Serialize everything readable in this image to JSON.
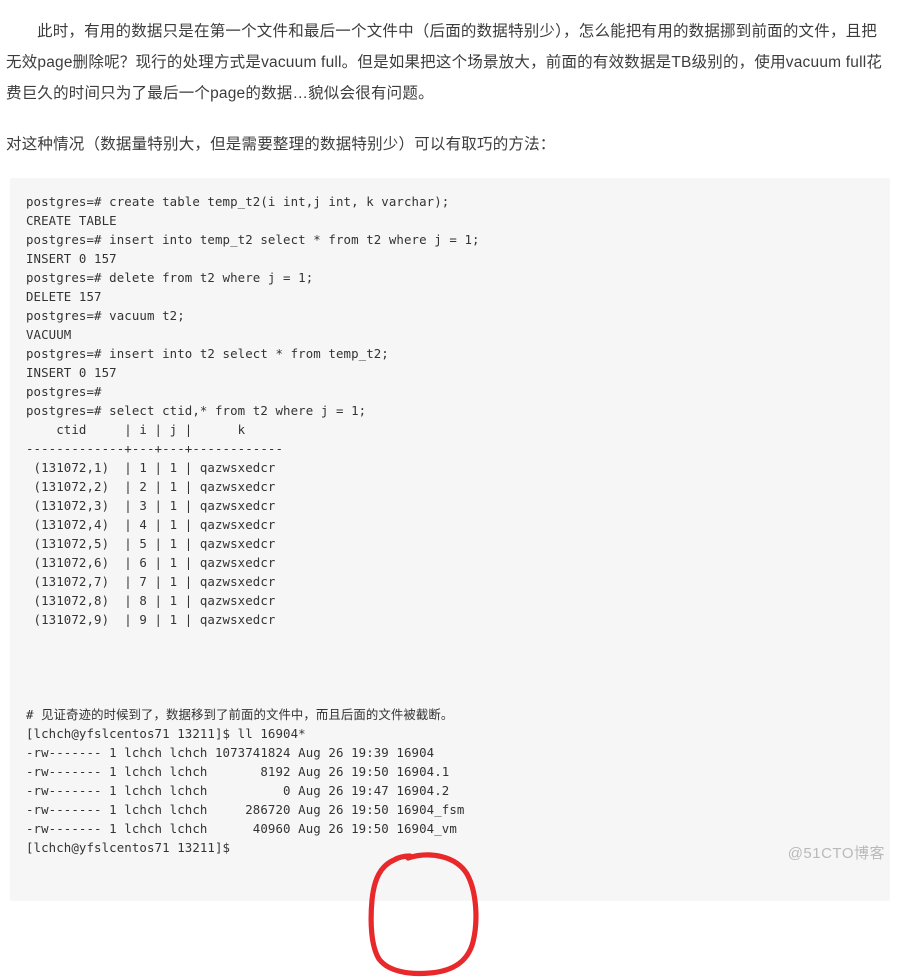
{
  "article": {
    "intro_paragraph": "此时，有用的数据只是在第一个文件和最后一个文件中（后面的数据特别少），怎么能把有用的数据挪到前面的文件，且把无效page删除呢？现行的处理方式是vacuum full。但是如果把这个场景放大，前面的有效数据是TB级别的，使用vacuum full花费巨久的时间只为了最后一个page的数据…貌似会很有问题。",
    "second_paragraph": "对这种情况（数据量特别大，但是需要整理的数据特别少）可以有取巧的方法："
  },
  "code_block": {
    "lines": [
      "postgres=# create table temp_t2(i int,j int, k varchar);",
      "CREATE TABLE",
      "postgres=# insert into temp_t2 select * from t2 where j = 1;",
      "INSERT 0 157",
      "postgres=# delete from t2 where j = 1;",
      "DELETE 157",
      "postgres=# vacuum t2;",
      "VACUUM",
      "postgres=# insert into t2 select * from temp_t2;",
      "INSERT 0 157",
      "postgres=#",
      "postgres=# select ctid,* from t2 where j = 1;",
      "    ctid     | i | j |      k",
      "-------------+---+---+------------",
      " (131072,1)  | 1 | 1 | qazwsxedcr",
      " (131072,2)  | 2 | 1 | qazwsxedcr",
      " (131072,3)  | 3 | 1 | qazwsxedcr",
      " (131072,4)  | 4 | 1 | qazwsxedcr",
      " (131072,5)  | 5 | 1 | qazwsxedcr",
      " (131072,6)  | 6 | 1 | qazwsxedcr",
      " (131072,7)  | 7 | 1 | qazwsxedcr",
      " (131072,8)  | 8 | 1 | qazwsxedcr",
      " (131072,9)  | 9 | 1 | qazwsxedcr",
      "",
      "",
      "# 见证奇迹的时候到了，数据移到了前面的文件中，而且后面的文件被截断。",
      "[lchch@yfslcentos71 13211]$ ll 16904*",
      "-rw------- 1 lchch lchch 1073741824 Aug 26 19:39 16904",
      "-rw------- 1 lchch lchch       8192 Aug 26 19:50 16904.1",
      "-rw------- 1 lchch lchch          0 Aug 26 19:47 16904.2",
      "-rw------- 1 lchch lchch     286720 Aug 26 19:50 16904_fsm",
      "-rw------- 1 lchch lchch      40960 Aug 26 19:50 16904_vm",
      "[lchch@yfslcentos71 13211]$"
    ]
  },
  "annotation": {
    "shape": "hand-drawn-ellipse",
    "color": "#e8282a",
    "encircles": "16904 16904.1 16904.2 16904_fsm 16904_vm"
  },
  "watermark": {
    "text": "@51CTO博客",
    "color": "#b9b9b9"
  }
}
